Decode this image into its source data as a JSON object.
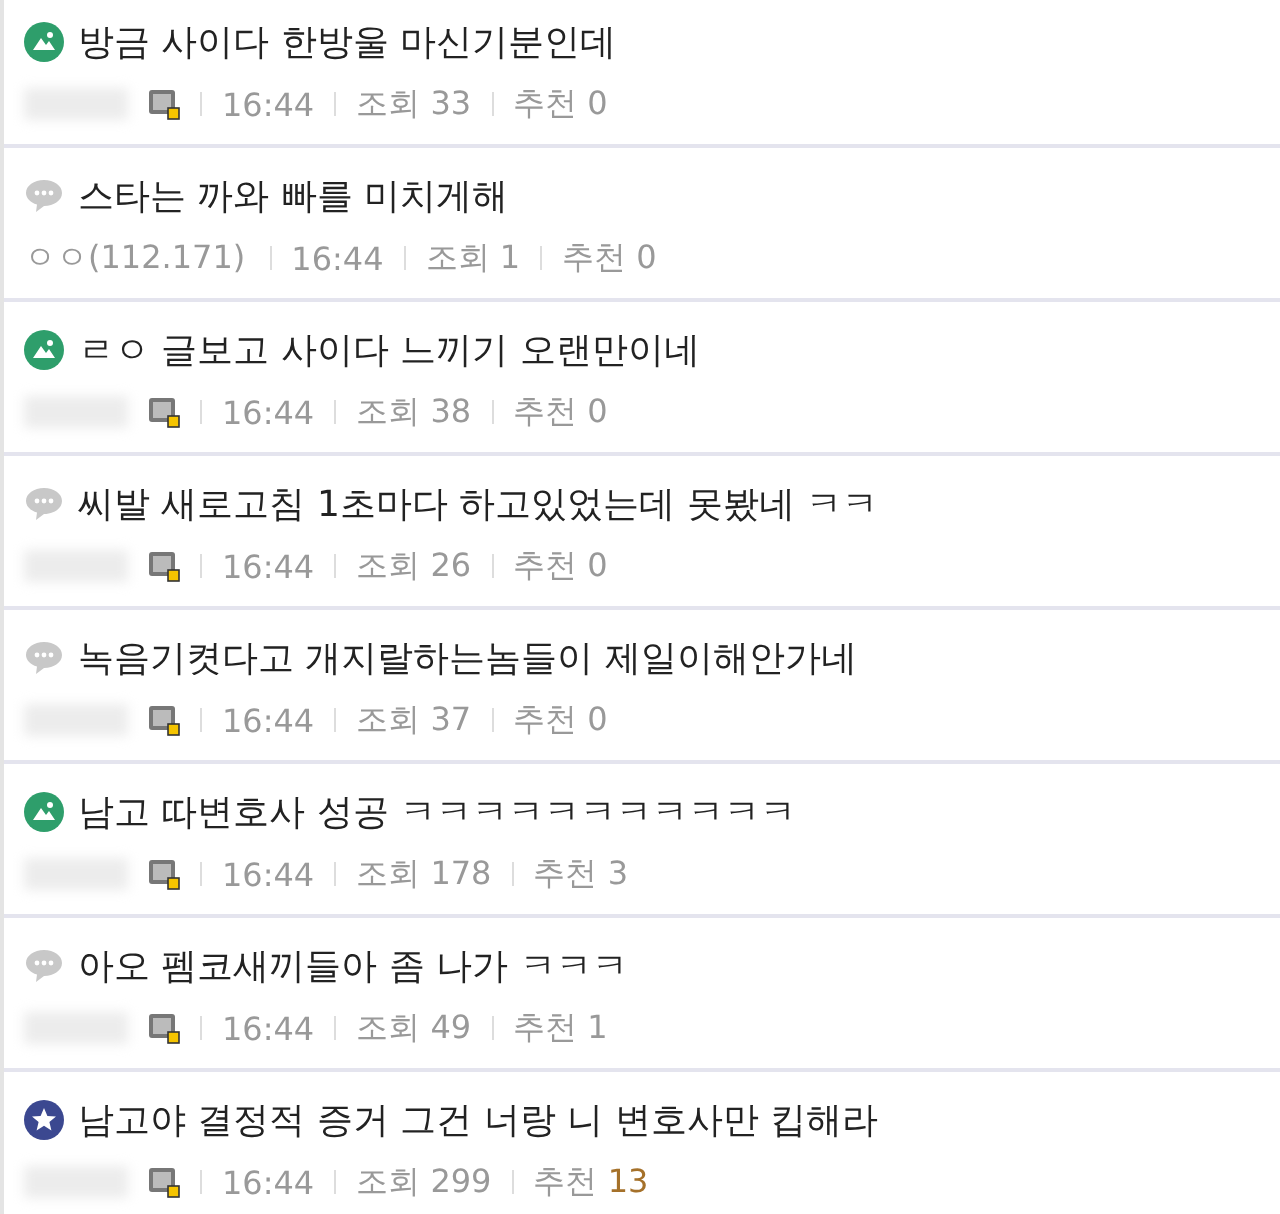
{
  "posts": [
    {
      "kind": "image",
      "title": "방금 사이다 한방울 마신기분인데",
      "author": {
        "kind": "hidden"
      },
      "member_icon": true,
      "time": "16:44",
      "views_label": "조회",
      "views": "33",
      "recommend_label": "추천",
      "recommend": "0",
      "recommend_hot": false
    },
    {
      "kind": "text",
      "title": "스타는 까와 빠를 미치게해",
      "author": {
        "kind": "shown",
        "name": "ㅇㅇ(112.171)"
      },
      "member_icon": false,
      "time": "16:44",
      "views_label": "조회",
      "views": "1",
      "recommend_label": "추천",
      "recommend": "0",
      "recommend_hot": false
    },
    {
      "kind": "image",
      "title": "ㄹㅇ 글보고 사이다 느끼기 오랜만이네",
      "author": {
        "kind": "hidden"
      },
      "member_icon": true,
      "time": "16:44",
      "views_label": "조회",
      "views": "38",
      "recommend_label": "추천",
      "recommend": "0",
      "recommend_hot": false
    },
    {
      "kind": "text",
      "title": "씨발 새로고침 1초마다 하고있었는데 못봤네 ㅋㅋ",
      "author": {
        "kind": "hidden"
      },
      "member_icon": true,
      "time": "16:44",
      "views_label": "조회",
      "views": "26",
      "recommend_label": "추천",
      "recommend": "0",
      "recommend_hot": false
    },
    {
      "kind": "text",
      "title": "녹음기켯다고 개지랄하는놈들이 제일이해안가네",
      "author": {
        "kind": "hidden"
      },
      "member_icon": true,
      "time": "16:44",
      "views_label": "조회",
      "views": "37",
      "recommend_label": "추천",
      "recommend": "0",
      "recommend_hot": false
    },
    {
      "kind": "image",
      "title": "남고 따변호사 성공 ㅋㅋㅋㅋㅋㅋㅋㅋㅋㅋㅋ",
      "author": {
        "kind": "hidden"
      },
      "member_icon": true,
      "time": "16:44",
      "views_label": "조회",
      "views": "178",
      "recommend_label": "추천",
      "recommend": "3",
      "recommend_hot": false
    },
    {
      "kind": "text",
      "title": "아오 펨코새끼들아 좀 나가 ㅋㅋㅋ",
      "author": {
        "kind": "hidden"
      },
      "member_icon": true,
      "time": "16:44",
      "views_label": "조회",
      "views": "49",
      "recommend_label": "추천",
      "recommend": "1",
      "recommend_hot": false
    },
    {
      "kind": "best",
      "title": "남고야 결정적 증거 그건 너랑 니 변호사만 킵해라",
      "author": {
        "kind": "hidden"
      },
      "member_icon": true,
      "time": "16:44",
      "views_label": "조회",
      "views": "299",
      "recommend_label": "추천",
      "recommend": "13",
      "recommend_hot": true
    }
  ]
}
